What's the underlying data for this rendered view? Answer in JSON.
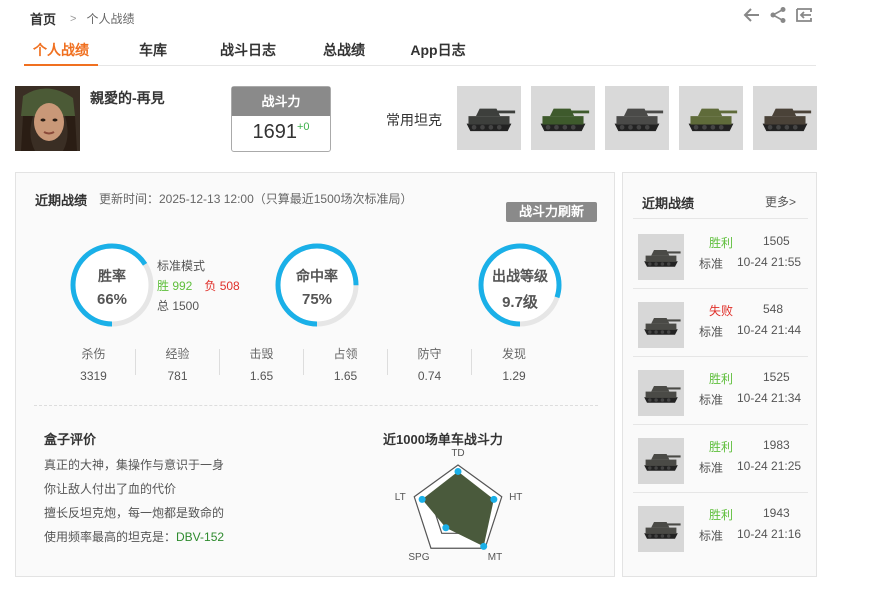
{
  "breadcrumb": {
    "home": "首页",
    "separator": ">",
    "current": "个人战绩"
  },
  "top_actions": [
    "back-arrow-icon",
    "share-icon",
    "exit-icon"
  ],
  "tabs": [
    {
      "label": "个人战绩",
      "active": true
    },
    {
      "label": "车库",
      "active": false
    },
    {
      "label": "战斗日志",
      "active": false
    },
    {
      "label": "总战绩",
      "active": false
    },
    {
      "label": "App日志",
      "active": false
    }
  ],
  "profile": {
    "name": "親愛的-再見",
    "power_label": "战斗力",
    "power_value": "1691",
    "power_delta": "+0",
    "fav_label": "常用坦克",
    "fav_tank_colors": [
      "#3d3f3c",
      "#3e5a2c",
      "#4a4a48",
      "#5f6b3a",
      "#4a4238"
    ]
  },
  "recent": {
    "title": "近期战绩",
    "update": "更新时间：2025-12-13 12:00（只算最近1500场次标准局）",
    "refresh": "战斗力刷新",
    "win_rate": {
      "label": "胜率",
      "value": "66%",
      "fraction": 0.66
    },
    "mode": {
      "label": "标准模式",
      "win": "胜 992",
      "loss": "负 508",
      "total": "总 1500"
    },
    "hit_rate": {
      "label": "命中率",
      "value": "75%",
      "fraction": 0.75
    },
    "level": {
      "label": "出战等级",
      "value": "9.7级",
      "fraction": 0.8
    },
    "stats": [
      {
        "label": "杀伤",
        "value": "3319"
      },
      {
        "label": "经验",
        "value": "781"
      },
      {
        "label": "击毁",
        "value": "1.65"
      },
      {
        "label": "占领",
        "value": "1.65"
      },
      {
        "label": "防守",
        "value": "0.74"
      },
      {
        "label": "发现",
        "value": "1.29"
      }
    ],
    "box": {
      "title": "盒子评价",
      "lines": [
        "真正的大神，集操作与意识于一身",
        "你让敌人付出了血的代价",
        "擅长反坦克炮，每一炮都是致命的"
      ],
      "fav_prefix": "使用频率最高的坦克是：",
      "fav_tank": "DBV-152"
    },
    "radar": {
      "title": "近1000场单车战斗力",
      "axes": [
        "TD",
        "HT",
        "MT",
        "SPG",
        "LT"
      ],
      "values": [
        0.86,
        0.82,
        0.95,
        0.45,
        0.82
      ],
      "fill": "#4a5a3c"
    }
  },
  "side": {
    "title": "近期战绩",
    "more": "更多>",
    "battles": [
      {
        "result": "胜利",
        "outcome": "win",
        "exp": "1505",
        "mode": "标准",
        "time": "10-24 21:55"
      },
      {
        "result": "失败",
        "outcome": "lose",
        "exp": "548",
        "mode": "标准",
        "time": "10-24 21:44"
      },
      {
        "result": "胜利",
        "outcome": "win",
        "exp": "1525",
        "mode": "标准",
        "time": "10-24 21:34"
      },
      {
        "result": "胜利",
        "outcome": "win",
        "exp": "1983",
        "mode": "标准",
        "time": "10-24 21:25"
      },
      {
        "result": "胜利",
        "outcome": "win",
        "exp": "1943",
        "mode": "标准",
        "time": "10-24 21:16"
      }
    ]
  },
  "colors": {
    "accent": "#f07020",
    "ring": "#1ab0e8",
    "ring_track": "#e6e6e6",
    "win": "#5fbf3c",
    "loss": "#e0302a"
  }
}
